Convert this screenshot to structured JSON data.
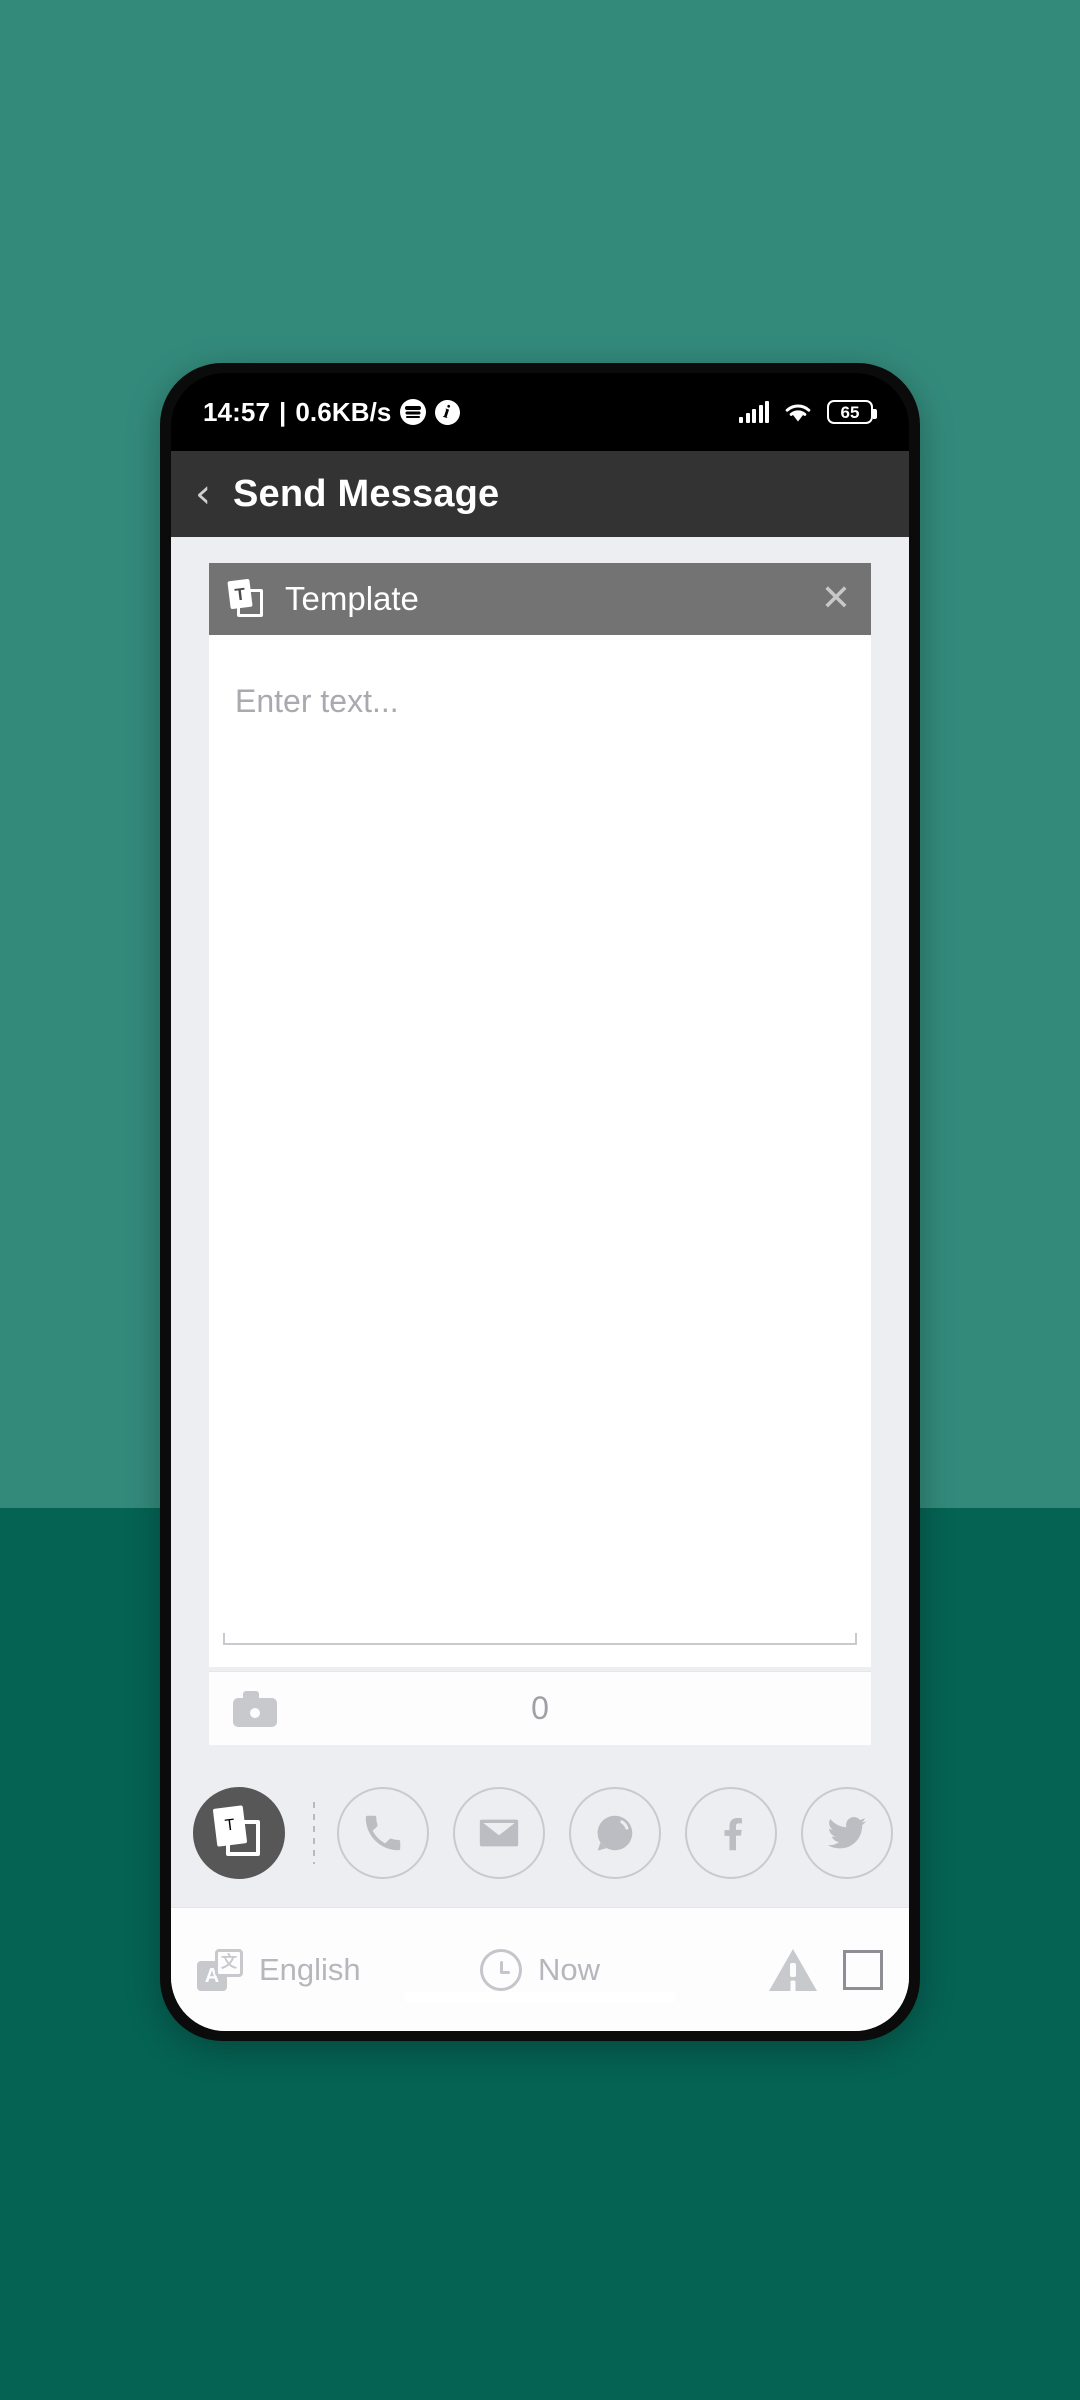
{
  "wallpaper": {
    "top_color": "#338a7b",
    "bottom_color": "#056354"
  },
  "status_bar": {
    "time": "14:57",
    "separator": "|",
    "network_speed": "0.6KB/s",
    "spotify_icon": "spotify-icon",
    "note_icon": "notification-icon",
    "signal_icon": "cellular-signal-icon",
    "wifi_icon": "wifi-icon",
    "battery_level": "65"
  },
  "app_bar": {
    "back_icon": "‹",
    "title": "Send Message"
  },
  "template_header": {
    "icon_letter": "T",
    "label": "Template",
    "close_icon": "✕"
  },
  "composer": {
    "placeholder": "Enter text...",
    "value": "",
    "camera_icon": "camera-icon",
    "character_count": "0"
  },
  "channels": [
    {
      "name": "template",
      "label": "Template",
      "icon": "template-icon",
      "active": true
    },
    {
      "name": "phone",
      "label": "Phone",
      "icon": "phone-icon",
      "active": false
    },
    {
      "name": "email",
      "label": "Email",
      "icon": "email-icon",
      "active": false
    },
    {
      "name": "chat",
      "label": "Chat",
      "icon": "chat-bubble-icon",
      "active": false
    },
    {
      "name": "facebook",
      "label": "Facebook",
      "icon": "facebook-icon",
      "active": false
    },
    {
      "name": "twitter",
      "label": "Twitter",
      "icon": "twitter-icon",
      "active": false
    }
  ],
  "bottom_bar": {
    "language_icon": "translate-icon",
    "language_glyph_a": "A",
    "language_glyph_cjk": "文",
    "language_label": "English",
    "time_icon": "clock-icon",
    "time_label": "Now",
    "warning_icon": "warning-icon",
    "checkbox_label": "select-all-checkbox",
    "checkbox_checked": false
  }
}
